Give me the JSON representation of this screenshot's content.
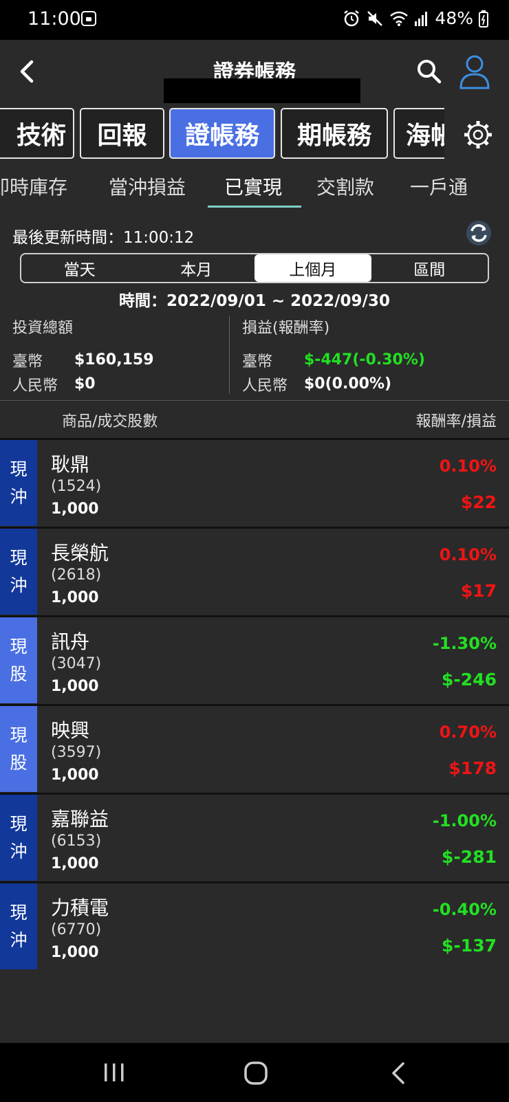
{
  "status_bar": {
    "time": "11:00",
    "battery": "48%"
  },
  "header": {
    "title": "證券帳務"
  },
  "tabs": [
    {
      "label": "技術",
      "active": false
    },
    {
      "label": "回報",
      "active": false
    },
    {
      "label": "證帳務",
      "active": true
    },
    {
      "label": "期帳務",
      "active": false
    },
    {
      "label": "海帳",
      "active": false
    }
  ],
  "subtabs": [
    "即時庫存",
    "當沖損益",
    "已實現",
    "交割款",
    "一戶通"
  ],
  "active_subtab": "已實現",
  "last_update": {
    "label": "最後更新時間：",
    "time": "11:00:12"
  },
  "period_options": [
    "當天",
    "本月",
    "上個月",
    "區間"
  ],
  "active_period": "上個月",
  "date_range": "時間：2022/09/01 ~ 2022/09/30",
  "summary": {
    "invest_title": "投資總額",
    "twd_label": "臺幣",
    "twd_invest": "$160,159",
    "rmb_label": "人民幣",
    "rmb_invest": "$0",
    "pl_title": "損益(報酬率)",
    "twd_pl": "$-447(-0.30%)",
    "rmb_pl": "$0(0.00%)"
  },
  "list_header": {
    "left": "商品/成交股數",
    "right": "報酬率/損益"
  },
  "rows": [
    {
      "type": "現沖",
      "type_chars": [
        "現",
        "沖"
      ],
      "name": "耿鼎",
      "code": "(1524)",
      "qty": "1,000",
      "rate": "0.10%",
      "pl": "$22"
    },
    {
      "type": "現沖",
      "type_chars": [
        "現",
        "沖"
      ],
      "name": "長榮航",
      "code": "(2618)",
      "qty": "1,000",
      "rate": "0.10%",
      "pl": "$17"
    },
    {
      "type": "現股",
      "type_chars": [
        "現",
        "股"
      ],
      "name": "訊舟",
      "code": "(3047)",
      "qty": "1,000",
      "rate": "-1.30%",
      "pl": "$-246"
    },
    {
      "type": "現股",
      "type_chars": [
        "現",
        "股"
      ],
      "name": "映興",
      "code": "(3597)",
      "qty": "1,000",
      "rate": "0.70%",
      "pl": "$178"
    },
    {
      "type": "現沖",
      "type_chars": [
        "現",
        "沖"
      ],
      "name": "嘉聯益",
      "code": "(6153)",
      "qty": "1,000",
      "rate": "-1.00%",
      "pl": "$-281"
    },
    {
      "type": "現沖",
      "type_chars": [
        "現",
        "沖"
      ],
      "name": "力積電",
      "code": "(6770)",
      "qty": "1,000",
      "rate": "-0.40%",
      "pl": "$-137"
    }
  ],
  "colors": {
    "profit": "#f01414",
    "loss": "#22e022",
    "accent": "#4a6fe3",
    "day_trade_badge": "#12389a"
  }
}
